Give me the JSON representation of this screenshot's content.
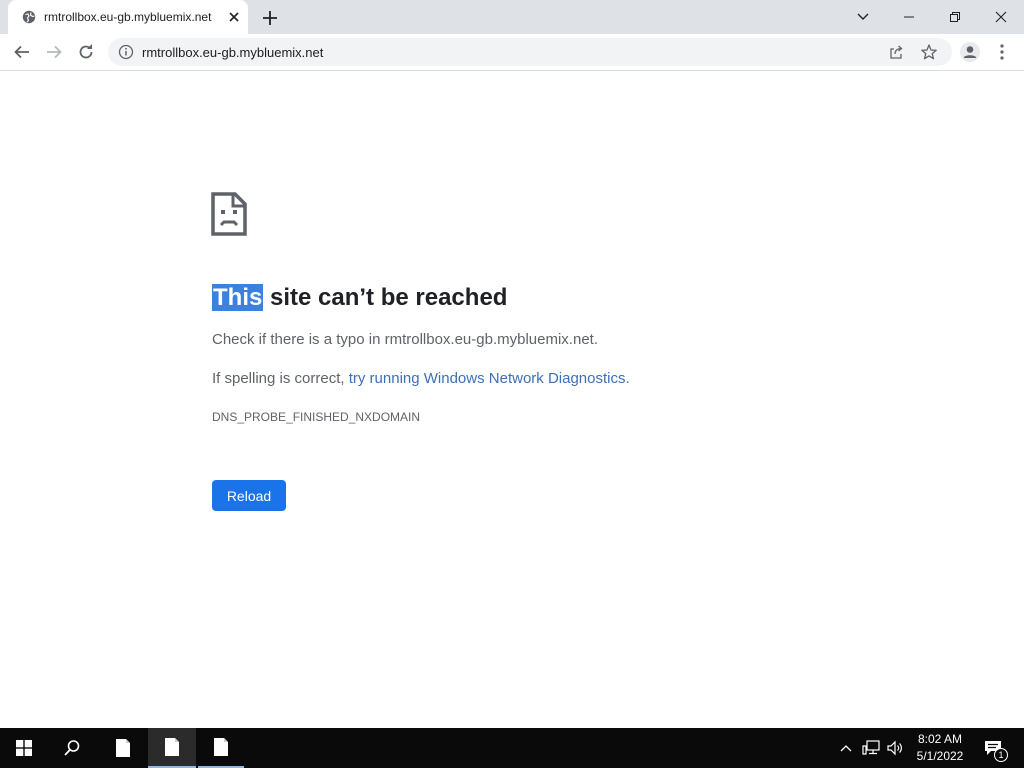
{
  "tab": {
    "title": "rmtrollbox.eu-gb.mybluemix.net",
    "favicon": "globe-icon",
    "close_icon": "close-icon"
  },
  "window_controls": [
    "chevron-down-icon",
    "minimize-icon",
    "restore-icon",
    "close-icon"
  ],
  "toolbar": {
    "back_icon": "arrow-left-icon",
    "forward_icon": "arrow-right-icon",
    "reload_icon": "reload-icon",
    "url": "rmtrollbox.eu-gb.mybluemix.net",
    "info_icon": "info-icon",
    "share_icon": "share-icon",
    "bookmark_icon": "star-icon",
    "profile_icon": "profile-icon",
    "menu_icon": "kebab-menu-icon"
  },
  "error_page": {
    "icon": "sad-document-icon",
    "heading_highlight": "This",
    "heading_rest": " site can’t be reached",
    "line1": "Check if there is a typo in rmtrollbox.eu-gb.mybluemix.net.",
    "line2_prefix": "If spelling is correct, ",
    "line2_link": "try running Windows Network Diagnostics",
    "line2_suffix": ".",
    "error_code": "DNS_PROBE_FINISHED_NXDOMAIN",
    "reload_label": "Reload",
    "accent_color": "#1a73e8",
    "link_color": "#3c6fb8"
  },
  "taskbar": {
    "start_icon": "windows-logo-icon",
    "search_icon": "search-icon",
    "apps": [
      "file-icon",
      "file-icon",
      "file-icon"
    ],
    "tray_icons": [
      "chevron-up-icon",
      "network-icon",
      "volume-icon"
    ],
    "time": "8:02 AM",
    "date": "5/1/2022",
    "notification_icon": "notification-icon",
    "notification_count": "1"
  }
}
